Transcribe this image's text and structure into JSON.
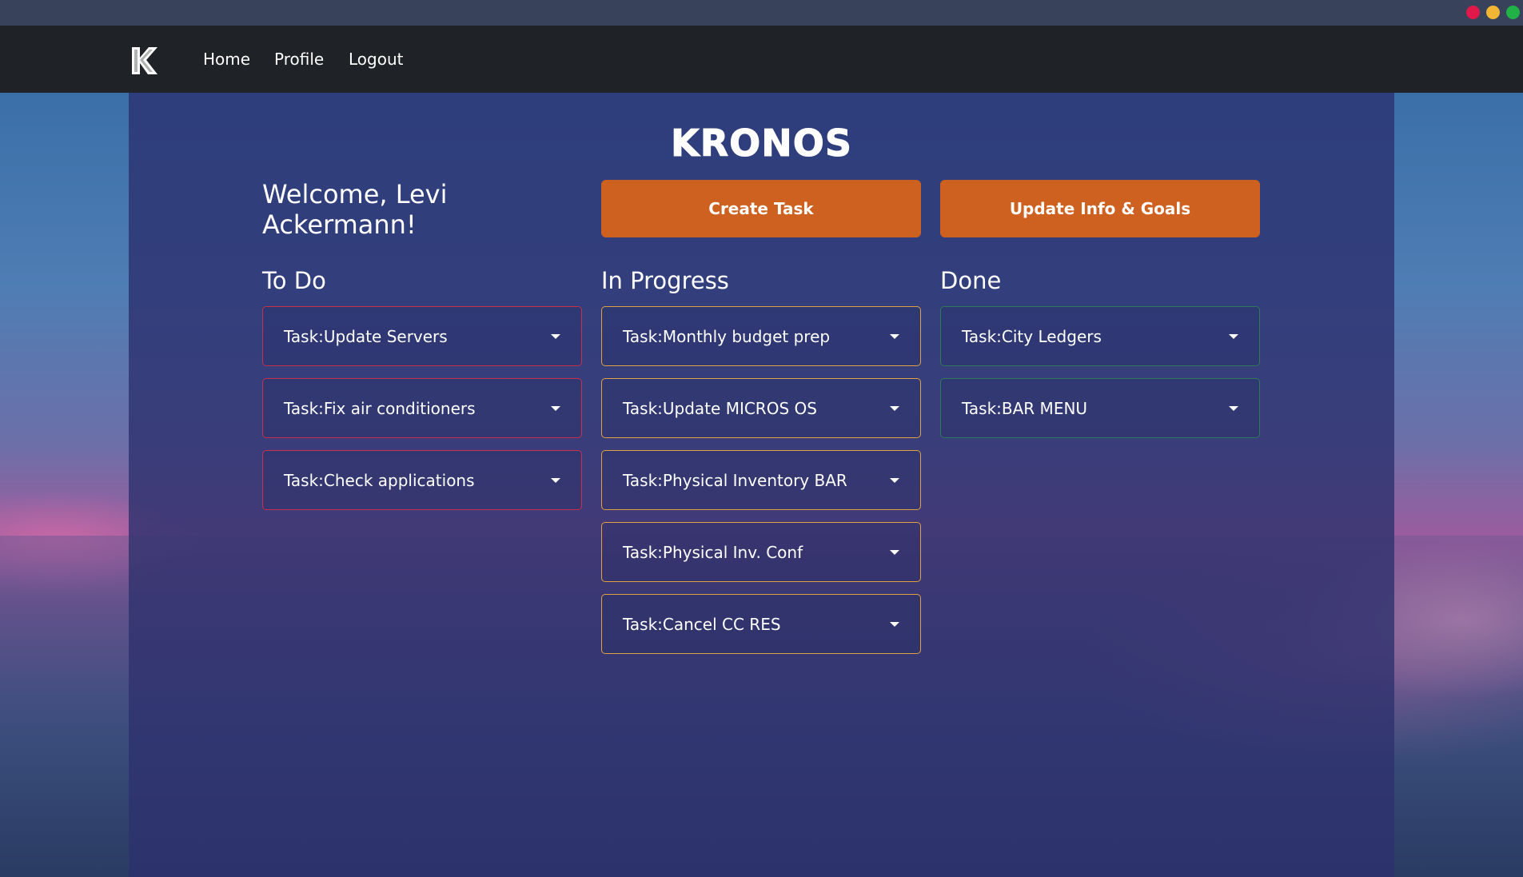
{
  "window": {
    "controls": [
      "close",
      "minimize",
      "maximize"
    ]
  },
  "nav": {
    "logo_icon": "kronos-k-logo",
    "links": [
      {
        "label": "Home"
      },
      {
        "label": "Profile"
      },
      {
        "label": "Logout"
      }
    ]
  },
  "app": {
    "title": "KRONOS"
  },
  "welcome": {
    "text": "Welcome, Levi Ackermann!"
  },
  "actions": {
    "create_task": "Create Task",
    "update_info": "Update Info & Goals",
    "button_color": "#cf6120"
  },
  "columns": [
    {
      "heading": "To Do",
      "border_color": "#c8304c",
      "tasks": [
        {
          "label": "Task:Update Servers"
        },
        {
          "label": "Task:Fix air conditioners"
        },
        {
          "label": "Task:Check applications"
        }
      ]
    },
    {
      "heading": "In Progress",
      "border_color": "#e0a140",
      "tasks": [
        {
          "label": "Task:Monthly budget prep"
        },
        {
          "label": "Task:Update MICROS OS"
        },
        {
          "label": "Task:Physical Inventory BAR"
        },
        {
          "label": "Task:Physical Inv. Conf"
        },
        {
          "label": "Task:Cancel CC RES"
        }
      ]
    },
    {
      "heading": "Done",
      "border_color": "#2f7a58",
      "tasks": [
        {
          "label": "Task:City Ledgers"
        },
        {
          "label": "Task:BAR MENU"
        }
      ]
    }
  ]
}
